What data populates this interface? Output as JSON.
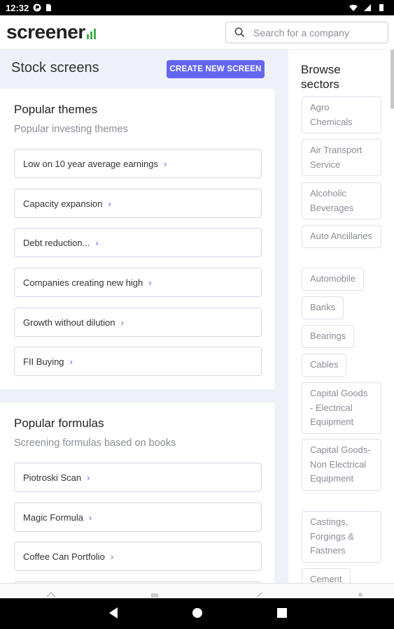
{
  "status_bar": {
    "time": "12:32"
  },
  "header": {
    "logo_text": "screener",
    "search": {
      "placeholder": "Search for a company",
      "value": ""
    }
  },
  "main": {
    "title": "Stock screens",
    "create_button": "CREATE NEW SCREEN",
    "popular_themes": {
      "title": "Popular themes",
      "subtitle": "Popular investing themes",
      "items": [
        "Low on 10 year average earnings",
        "Capacity expansion",
        "Debt reduction...",
        "Companies creating new high",
        "Growth without dilution",
        "FII Buying"
      ]
    },
    "popular_formulas": {
      "title": "Popular formulas",
      "subtitle": "Screening formulas based on books",
      "items": [
        "Piotroski Scan",
        "Magic Formula",
        "Coffee Can Portfolio"
      ]
    }
  },
  "sidebar": {
    "title": "Browse sectors",
    "sectors": [
      "Agro Chemicals",
      "Air Transport Service",
      "Alcoholic Beverages",
      "Auto Ancillaries",
      "Automobile",
      "Banks",
      "Bearings",
      "Cables",
      "Capital Goods - Electrical Equipment",
      "Capital Goods-Non Electrical Equipment",
      "Castings, Forgings & Fastners",
      "Cement"
    ]
  },
  "colors": {
    "accent": "#6366f1",
    "logo_green": "#41b04d",
    "page_bg": "#eef1f8"
  }
}
